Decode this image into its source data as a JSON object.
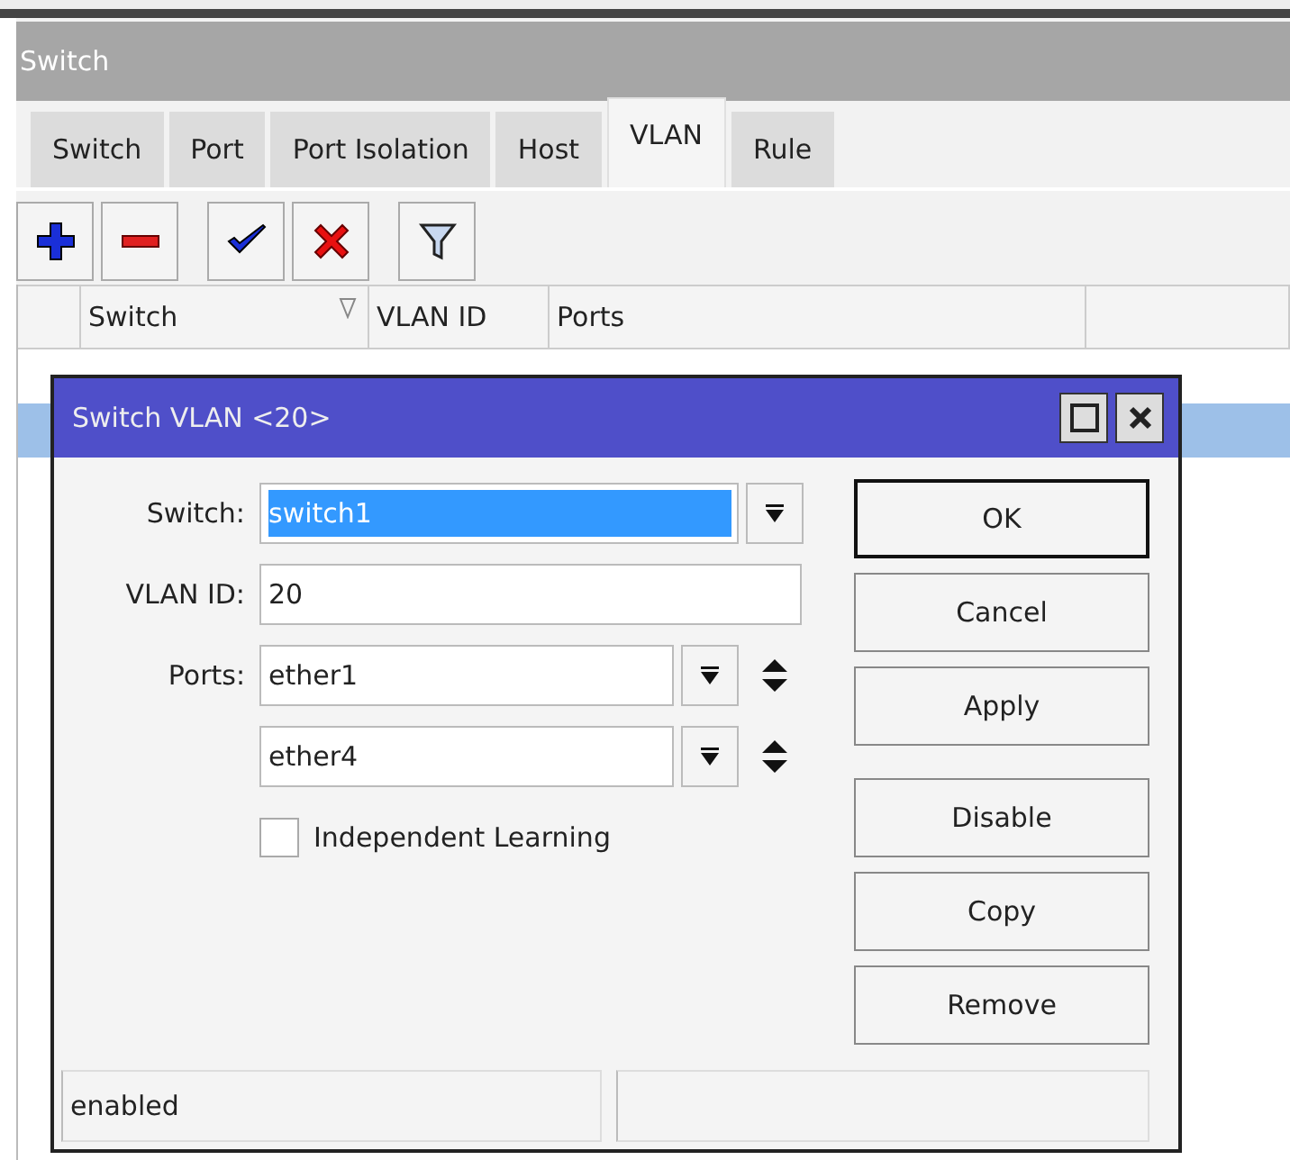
{
  "window": {
    "title": "Switch"
  },
  "tabs": [
    {
      "label": "Switch",
      "selected": false
    },
    {
      "label": "Port",
      "selected": false
    },
    {
      "label": "Port Isolation",
      "selected": false
    },
    {
      "label": "Host",
      "selected": false
    },
    {
      "label": "VLAN",
      "selected": true
    },
    {
      "label": "Rule",
      "selected": false
    }
  ],
  "toolbar": [
    {
      "kind": "add"
    },
    {
      "kind": "remove"
    },
    {
      "kind": "enable"
    },
    {
      "kind": "disable"
    },
    {
      "kind": "filter"
    }
  ],
  "table": {
    "columns": [
      {
        "label": "Switch",
        "sorted": true
      },
      {
        "label": "VLAN ID",
        "sorted": false
      },
      {
        "label": "Ports",
        "sorted": false
      }
    ],
    "rows": [
      {
        "selected": false
      },
      {
        "selected": true
      }
    ]
  },
  "dialog": {
    "title": "Switch VLAN <20>",
    "switch": {
      "label": "Switch:",
      "value": "switch1",
      "text_selected": true
    },
    "vlan_id": {
      "label": "VLAN ID:",
      "value": "20"
    },
    "ports": {
      "label": "Ports:",
      "values": [
        "ether1",
        "ether4"
      ]
    },
    "independent_learning": {
      "label": "Independent Learning",
      "checked": false
    },
    "buttons": [
      {
        "label": "OK",
        "default": true
      },
      {
        "label": "Cancel",
        "default": false
      },
      {
        "label": "Apply",
        "default": false
      },
      {
        "label": "Disable",
        "default": false
      },
      {
        "label": "Copy",
        "default": false
      },
      {
        "label": "Remove",
        "default": false
      }
    ],
    "status": "enabled"
  }
}
